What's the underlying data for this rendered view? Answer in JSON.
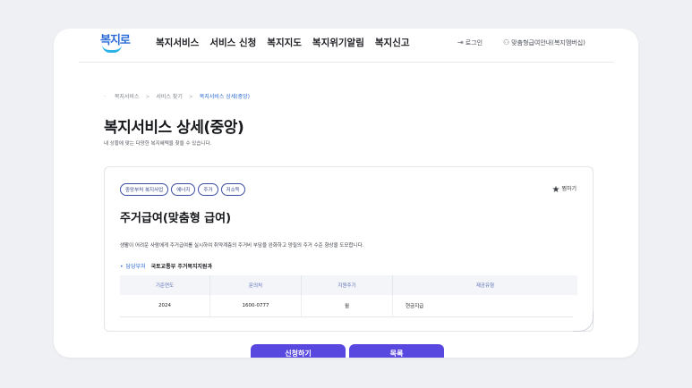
{
  "header": {
    "logo_text": "복지로",
    "nav": [
      "복지서비스",
      "서비스 신청",
      "복지지도",
      "복지위기알림",
      "복지신고"
    ],
    "login_label": "로그인",
    "login_icon": "login-icon",
    "guide_label": "맞춤형급여안내(복지멤버십)",
    "guide_icon": "person-icon"
  },
  "breadcrumb": {
    "home": "·",
    "items": [
      "복지서비스",
      "서비스 찾기",
      "복지서비스 상세(중앙)"
    ],
    "separator": ">"
  },
  "page": {
    "title": "복지서비스 상세(중앙)",
    "subtitle": "내 상황에 맞는 다양한 복지혜택을 찾을 수 있습니다."
  },
  "service": {
    "tags": [
      "중앙부처 복지사업",
      "에너지",
      "주거",
      "저소득"
    ],
    "favorite_label": "찜하기",
    "title": "주거급여(맞춤형 급여)",
    "description": "생활이 어려운 사람에게 주거급여를 실시하여 취약계층의 주거비 부담을 완화하고 양질의 주거 수준 향상을 도모합니다.",
    "dept_label": "담당부처",
    "dept_value": "국토교통부 주거복지지원과",
    "table": {
      "headers": [
        "기준연도",
        "문의처",
        "지원주기",
        "제공유형"
      ],
      "row": [
        "2024",
        "1600-0777",
        "월",
        "현금지급"
      ]
    }
  },
  "actions": {
    "apply_label": "신청하기",
    "list_label": "목록"
  },
  "colors": {
    "accent": "#2a6bd8",
    "button": "#5848e0",
    "tag_border": "#3b4fa0"
  }
}
